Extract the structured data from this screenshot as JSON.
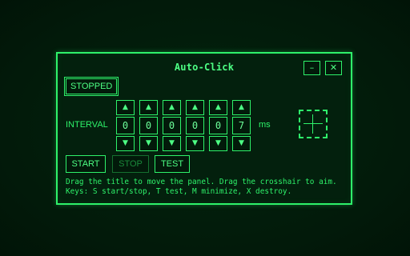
{
  "window": {
    "title": "Auto-Click",
    "minimize_label": "–",
    "close_label": "✕"
  },
  "status": {
    "label": "STOPPED"
  },
  "interval": {
    "label": "INTERVAL",
    "unit": "ms",
    "up_label": "▲",
    "down_label": "▼",
    "digits": [
      "0",
      "0",
      "0",
      "0",
      "0",
      "7"
    ]
  },
  "crosshair": {
    "icon": "crosshair-icon"
  },
  "controls": {
    "start_label": "START",
    "stop_label": "STOP",
    "test_label": "TEST"
  },
  "help": {
    "line1": "Drag the title to move the panel. Drag the crosshair to aim.",
    "line2": "Keys: S start/stop, T test, M minimize, X destroy."
  },
  "colors": {
    "accent": "#2ef26a",
    "background": "#021a0a",
    "disabled": "#1b8a3b"
  }
}
